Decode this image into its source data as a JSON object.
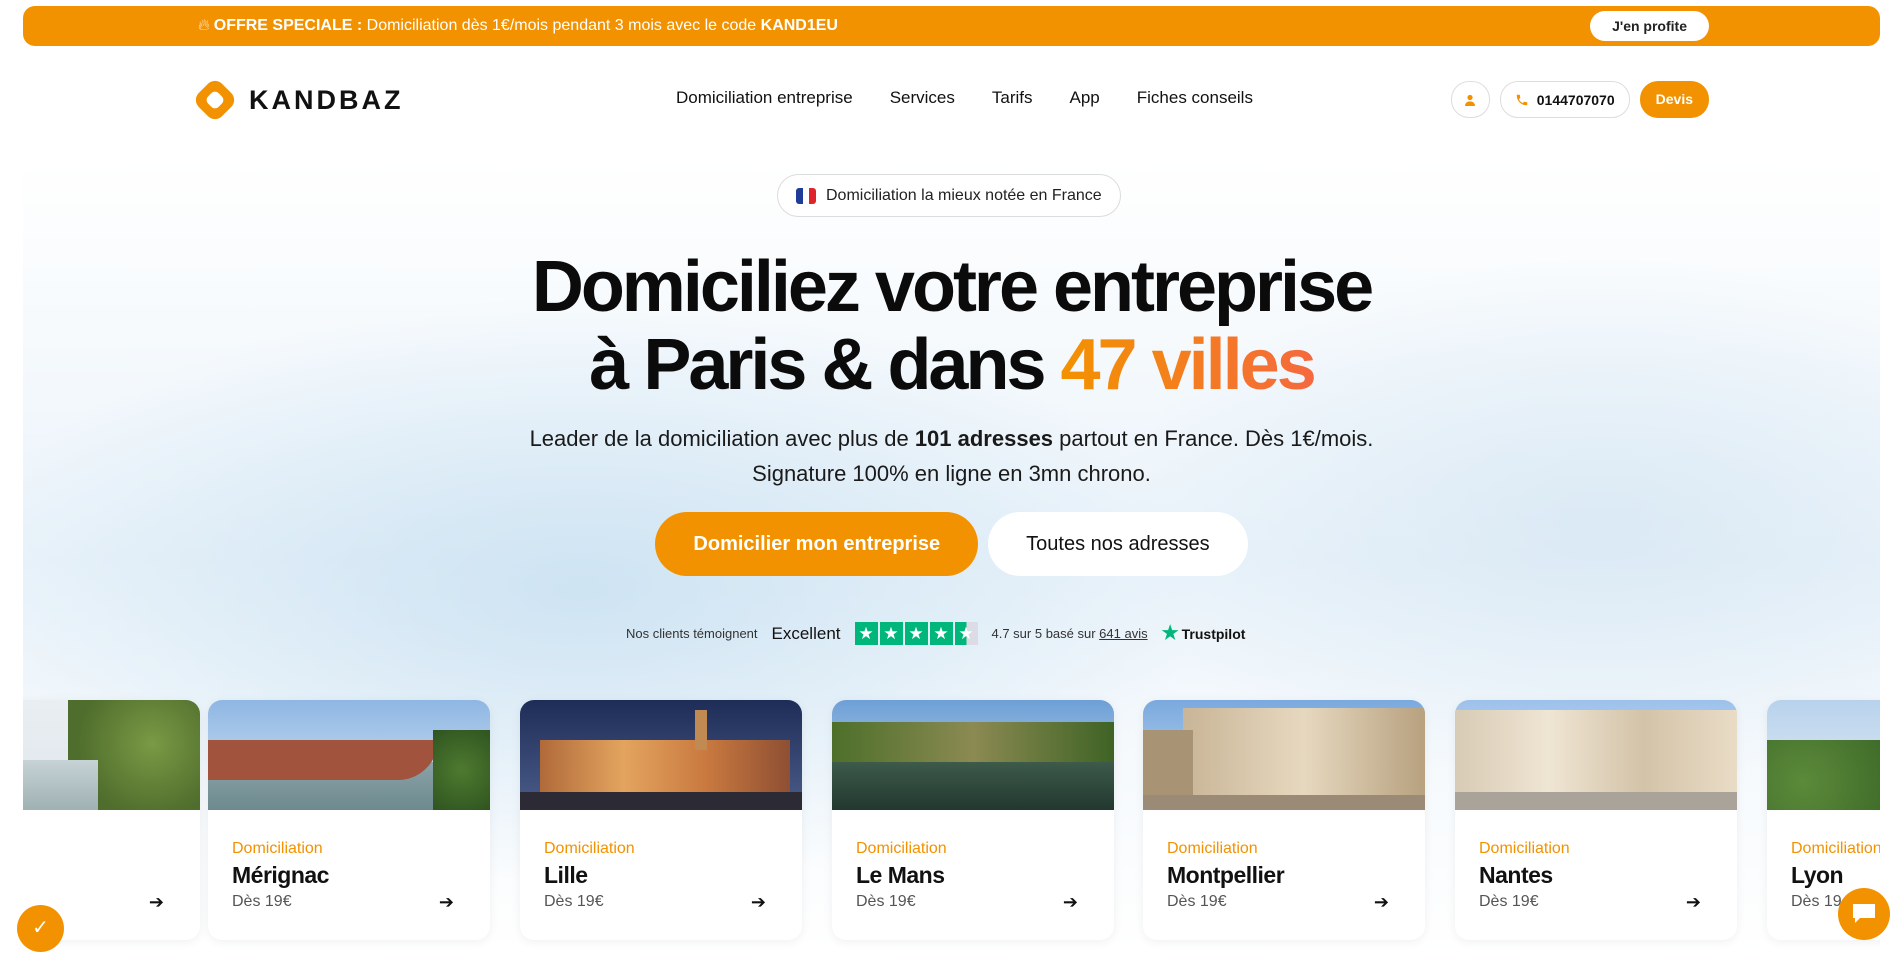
{
  "promo": {
    "icon": "fire-icon",
    "label_bold": "OFFRE SPECIALE :",
    "text": " Domiciliation dès 1€/mois pendant 3 mois avec le code ",
    "code": "KAND1EU",
    "cta": "J'en profite"
  },
  "header": {
    "brand": "KANDBAZ",
    "nav": [
      "Domiciliation entreprise",
      "Services",
      "Tarifs",
      "App",
      "Fiches conseils"
    ],
    "phone": "0144707070",
    "devis": "Devis"
  },
  "hero": {
    "badge": "Domiciliation la mieux notée en France",
    "title_line1": "Domiciliez votre entreprise",
    "title_line2_a": "à Paris & dans ",
    "title_line2_accent": "47 villes",
    "sub_a": "Leader de la domiciliation avec plus de ",
    "sub_bold": "101 adresses",
    "sub_b": " partout en France.  Dès 1€/mois.",
    "sub_line2": "Signature 100% en ligne en 3mn chrono.",
    "cta_primary": "Domicilier mon entreprise",
    "cta_secondary": "Toutes nos adresses"
  },
  "trust": {
    "intro": "Nos clients témoignent",
    "rating_word": "Excellent",
    "stars": 4.5,
    "score_text": "4.7 sur 5 basé sur ",
    "reviews_link": "641 avis",
    "brand": "Trustpilot"
  },
  "cards": [
    {
      "label": "",
      "city": "",
      "price": ""
    },
    {
      "label": "Domiciliation",
      "city": "Mérignac",
      "price": "Dès 19€"
    },
    {
      "label": "Domiciliation",
      "city": "Lille",
      "price": "Dès 19€"
    },
    {
      "label": "Domiciliation",
      "city": "Le Mans",
      "price": "Dès 19€"
    },
    {
      "label": "Domiciliation",
      "city": "Montpellier",
      "price": "Dès 19€"
    },
    {
      "label": "Domiciliation",
      "city": "Nantes",
      "price": "Dès 19€"
    },
    {
      "label": "Domiciliation",
      "city": "Lyon",
      "price": "Dès 19"
    }
  ],
  "colors": {
    "brand_orange": "#f39200",
    "accent_gradient_end": "#f4693f",
    "trustpilot_green": "#00b67a"
  }
}
